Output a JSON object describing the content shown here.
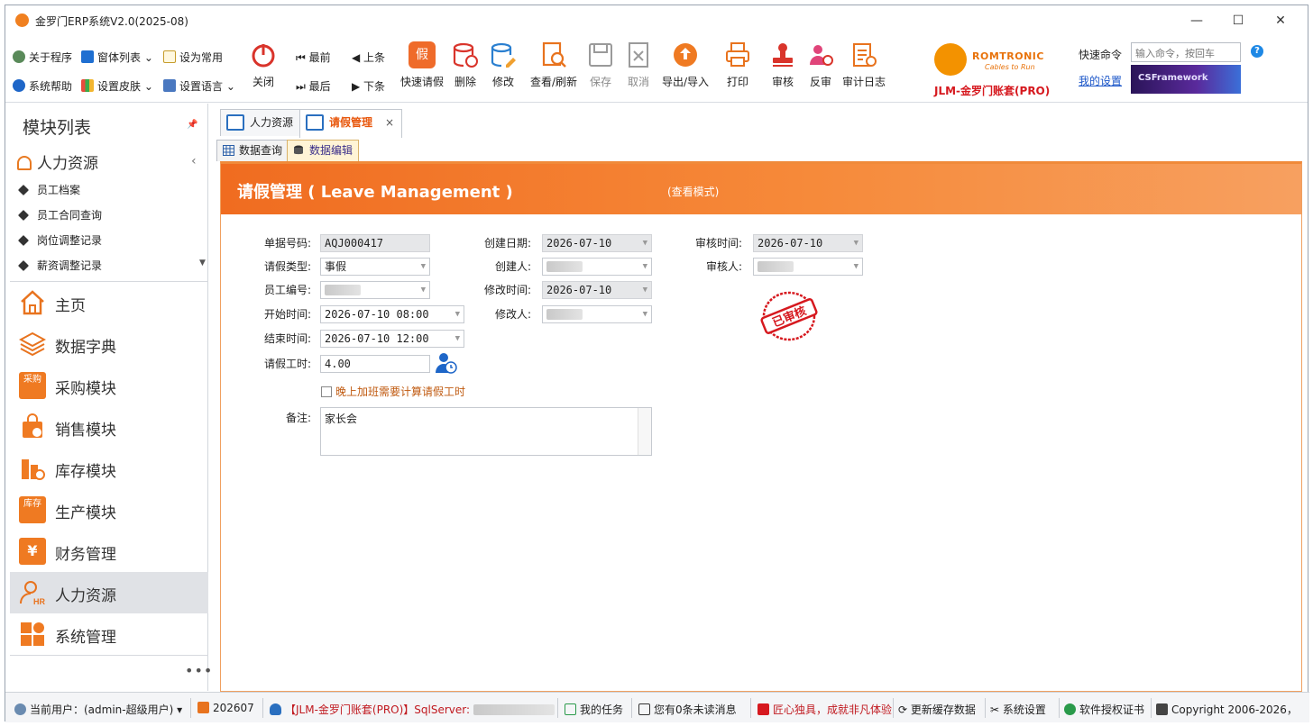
{
  "window": {
    "title": "金罗门ERP系统V2.0(2025-08)",
    "min": "—",
    "max": "☐",
    "close": "✕"
  },
  "ribbon": {
    "small": {
      "about": "关于程序",
      "windows": "窗体列表",
      "set_common": "设为常用",
      "help": "系统帮助",
      "skin": "设置皮肤",
      "language": "设置语言",
      "first": "最前",
      "prev": "上条",
      "last": "最后",
      "next": "下条"
    },
    "big": {
      "close": "关闭",
      "quick_leave": "快速请假",
      "delete": "删除",
      "edit": "修改",
      "view": "查看/刷新",
      "save": "保存",
      "cancel": "取消",
      "export": "导出/导入",
      "print": "打印",
      "approve": "审核",
      "unapprove": "反审",
      "audit_log": "审计日志"
    },
    "brand": {
      "name": "ROMTRONIC",
      "slogan": "Cables to Run",
      "account": "JLM-金罗门账套(PRO)"
    },
    "quick_cmd_label": "快速命令",
    "quick_cmd_placeholder": "输入命令，按回车",
    "my_settings": "我的设置",
    "csf": "CSFramework"
  },
  "sidebar": {
    "title": "模块列表",
    "group": "人力资源",
    "sub_items": [
      "员工档案",
      "员工合同查询",
      "岗位调整记录",
      "薪资调整记录"
    ],
    "modules": [
      "主页",
      "数据字典",
      "采购模块",
      "销售模块",
      "库存模块",
      "生产模块",
      "财务管理",
      "人力资源",
      "系统管理"
    ],
    "more": "•••"
  },
  "tabs": {
    "hr": "人力资源",
    "leave": "请假管理",
    "close": "×"
  },
  "subtabs": {
    "query": "数据查询",
    "edit": "数据编辑"
  },
  "form": {
    "title": "请假管理 ( Leave Management )",
    "mode": "(查看模式)",
    "labels": {
      "doc_no": "单据号码:",
      "leave_type": "请假类型:",
      "emp_no": "员工编号:",
      "start": "开始时间:",
      "end": "结束时间:",
      "hours": "请假工时:",
      "create_date": "创建日期:",
      "creator": "创建人:",
      "modify_time": "修改时间:",
      "modifier": "修改人:",
      "approve_time": "审核时间:",
      "approver": "审核人:",
      "remark": "备注:"
    },
    "values": {
      "doc_no": "AQJ000417",
      "leave_type": "事假",
      "start": "2026-07-10 08:00",
      "end": "2026-07-10 12:00",
      "hours": "4.00",
      "create_date": "2026-07-10",
      "modify_time": "2026-07-10",
      "approve_time": "2026-07-10",
      "remark": "家长会"
    },
    "checkbox": "晚上加班需要计算请假工时",
    "stamp": "已审核"
  },
  "status": {
    "user": "当前用户：(admin-超级用户)",
    "period": "202607",
    "db": "【JLM-金罗门账套(PRO)】SqlServer:",
    "tasks": "我的任务",
    "messages": "您有0条未读消息",
    "slogan": "匠心独具，成就非凡体验",
    "refresh": "更新缓存数据",
    "settings": "系统设置",
    "license": "软件授权证书",
    "copyright": "Copyright 2006-2026，"
  },
  "colors": {
    "accent": "#f06c20",
    "brand_red": "#d6191f",
    "link": "#1a55c8"
  }
}
